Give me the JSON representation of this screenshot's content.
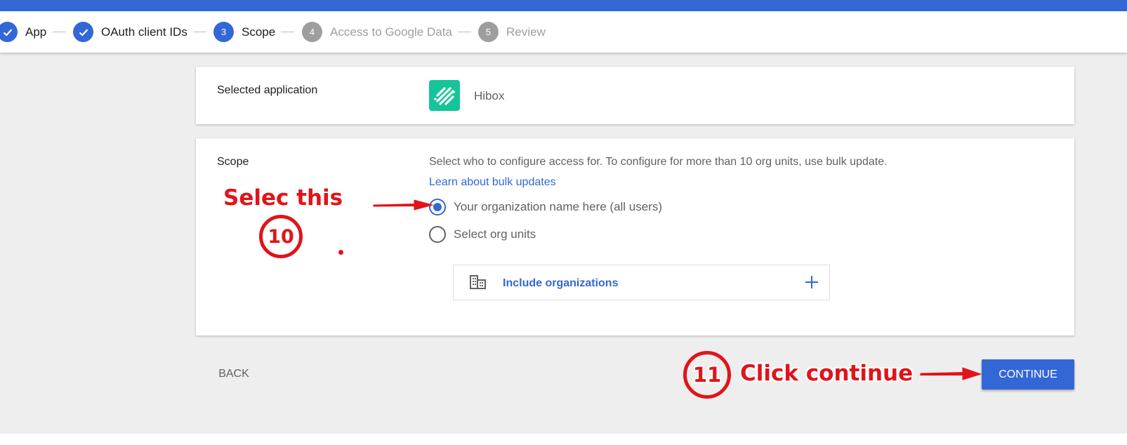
{
  "stepper": {
    "steps": [
      {
        "number": "",
        "label": "App",
        "state": "done"
      },
      {
        "number": "",
        "label": "OAuth client IDs",
        "state": "done"
      },
      {
        "number": "3",
        "label": "Scope",
        "state": "active"
      },
      {
        "number": "4",
        "label": "Access to Google Data",
        "state": "todo"
      },
      {
        "number": "5",
        "label": "Review",
        "state": "todo"
      }
    ]
  },
  "selected_app": {
    "label": "Selected application",
    "app_name": "Hibox",
    "logo_color": "#16c49a"
  },
  "scope": {
    "label": "Scope",
    "description": "Select who to configure access for. To configure for more than 10 org units, use bulk update.",
    "link": "Learn about bulk updates",
    "options": [
      {
        "label": "Your organization name here (all users)",
        "checked": true
      },
      {
        "label": "Select org units",
        "checked": false
      }
    ],
    "include_label": "Include organizations"
  },
  "actions": {
    "back_label": "BACK",
    "continue_label": "CONTINUE"
  },
  "annotations": {
    "step10_text": "Selec this",
    "step10_number": "10",
    "step11_number": "11",
    "step11_text": "Click continue"
  },
  "colors": {
    "accent": "#3367d6",
    "annotation": "#e0141a",
    "background": "#eeeeee"
  }
}
